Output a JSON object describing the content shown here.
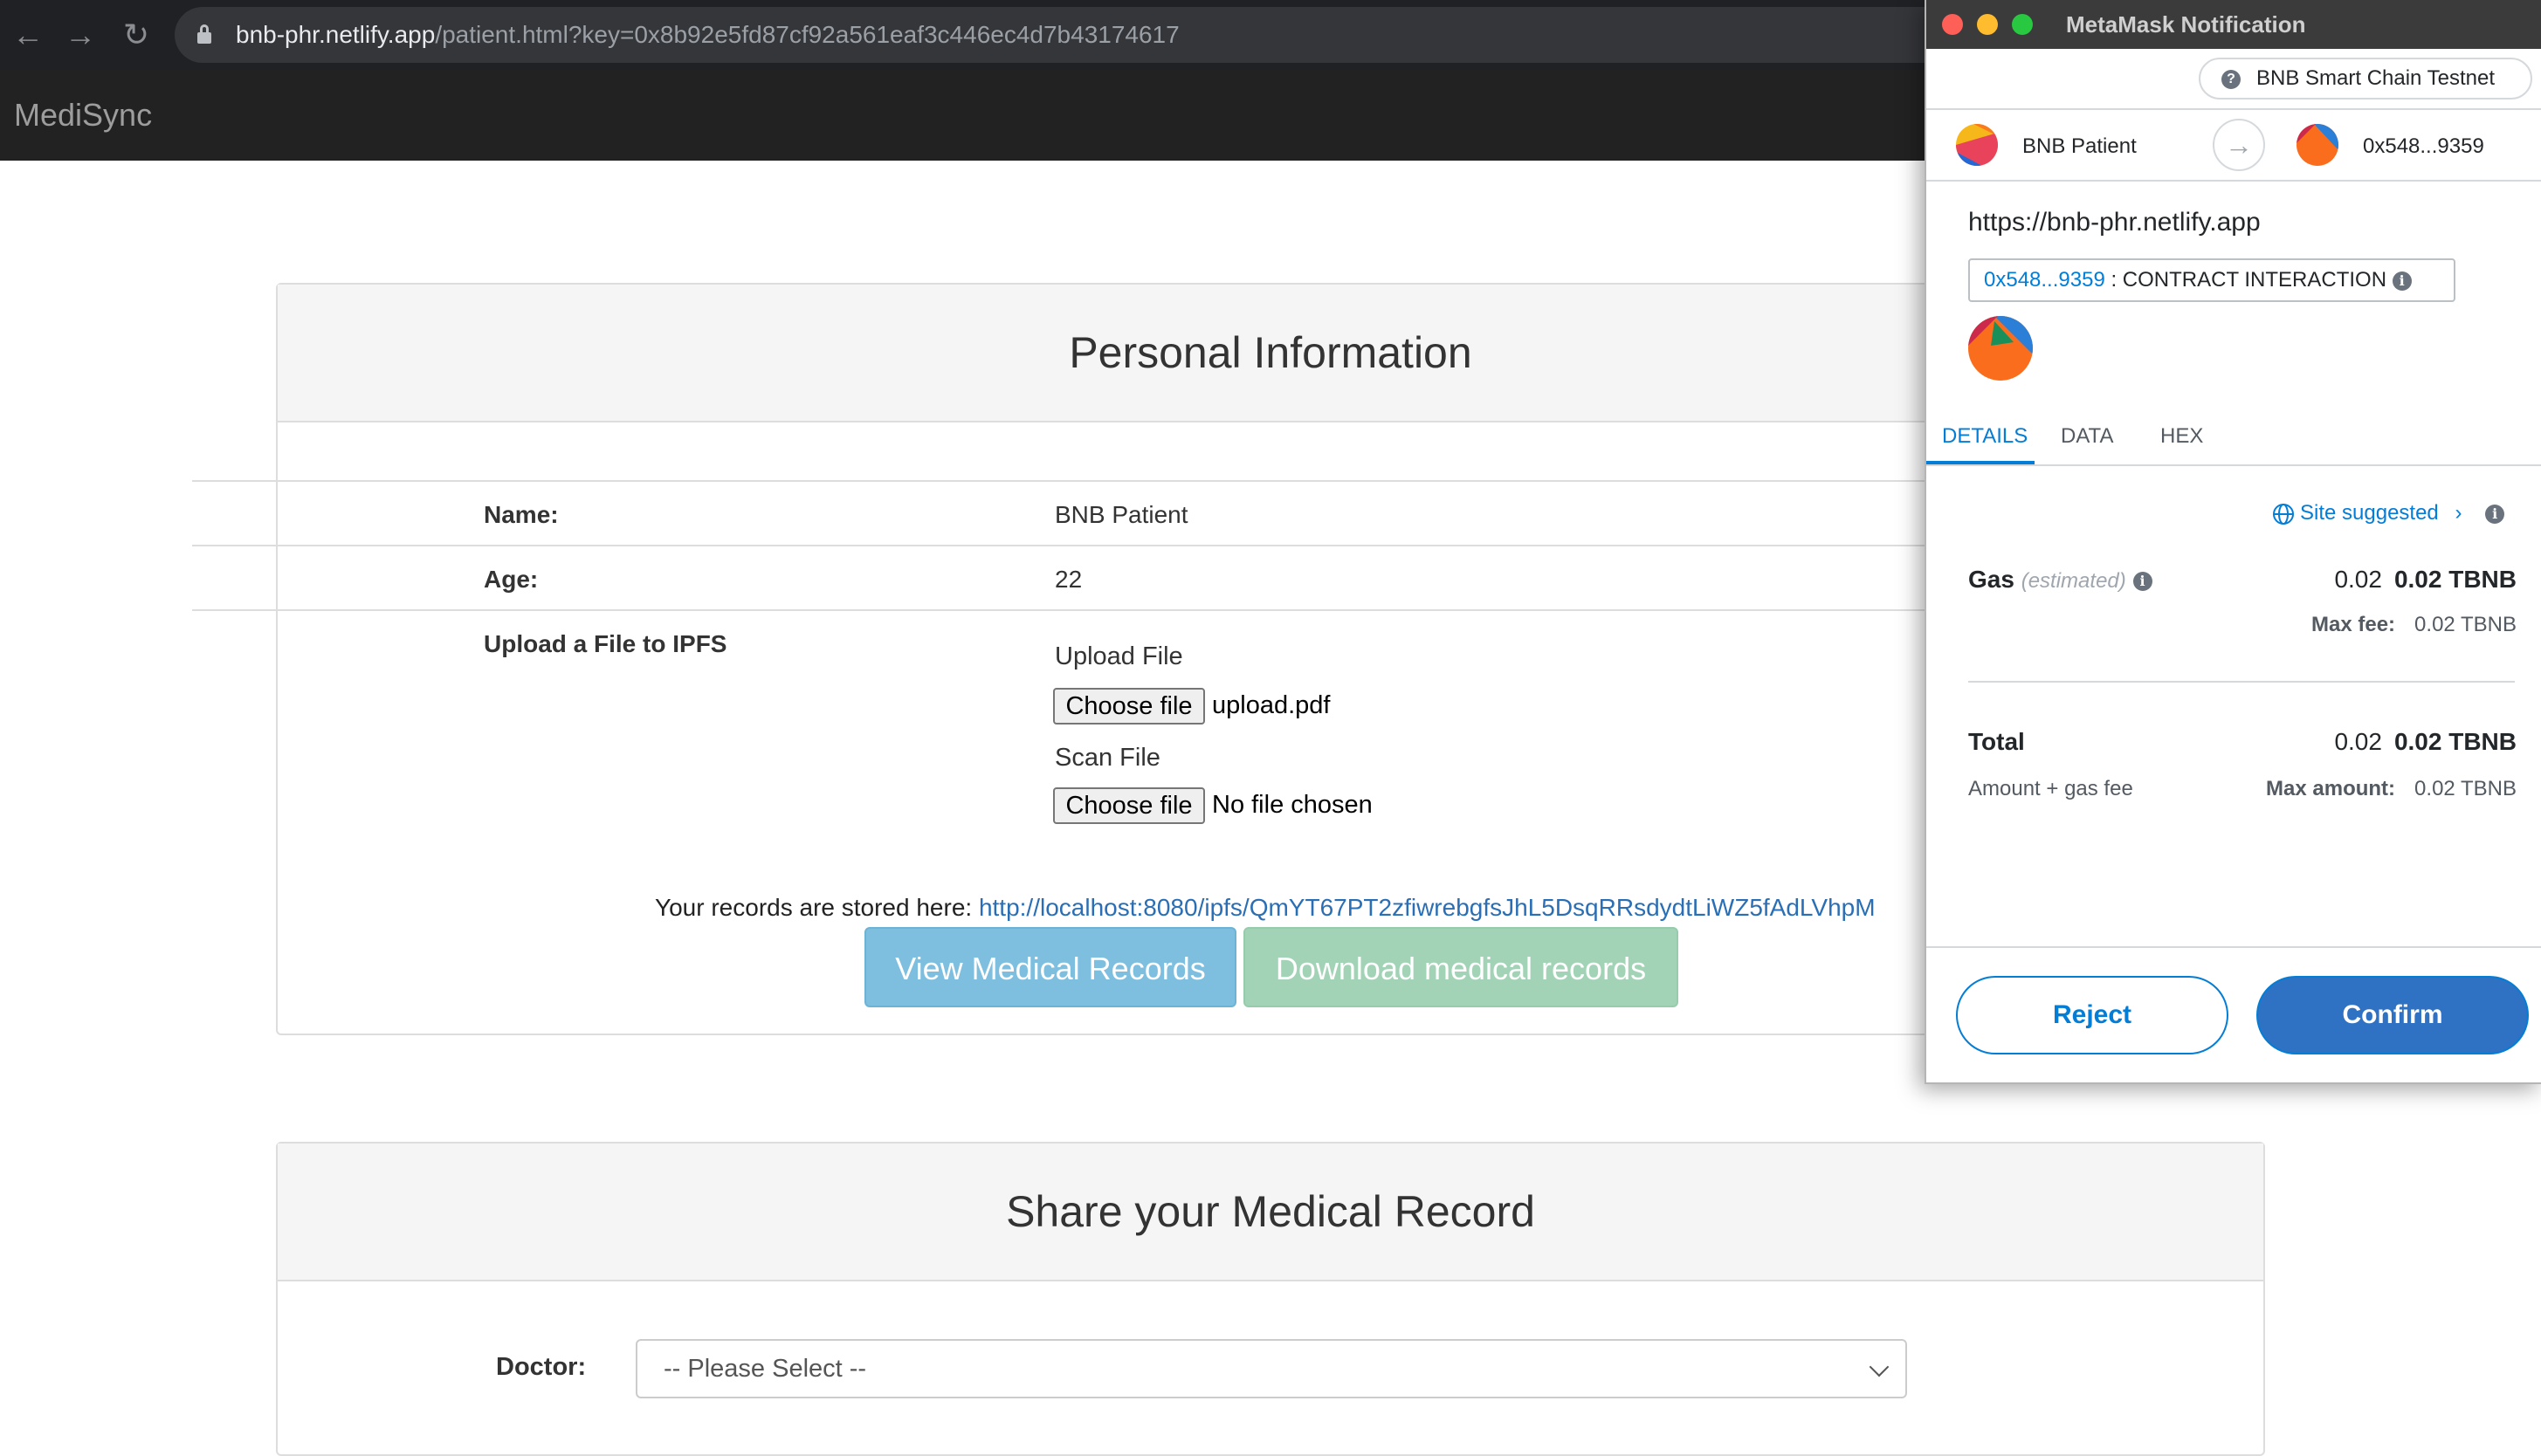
{
  "browser": {
    "url_host": "bnb-phr.netlify.app",
    "url_path": "/patient.html?key=0x8b92e5fd87cf92a561eaf3c446ec4d7b43174617"
  },
  "app": {
    "brand": "MediSync"
  },
  "personal": {
    "title": "Personal Information",
    "name_label": "Name:",
    "name_value": "BNB Patient",
    "age_label": "Age:",
    "age_value": "22",
    "upload_label": "Upload a File to IPFS",
    "upload_file_heading": "Upload File",
    "upload_button": "Choose file",
    "upload_file_name": "upload.pdf",
    "scan_file_heading": "Scan File",
    "scan_button": "Choose file",
    "scan_file_name": "No file chosen",
    "records_prefix": "Your records are stored here:",
    "records_link": "http://localhost:8080/ipfs/QmYT67PT2zfiwrebgfsJhL5DsqRRsdydtLiWZ5fAdLVhpM",
    "view_button": "View Medical Records",
    "download_button": "Download medical records"
  },
  "share": {
    "title": "Share your Medical Record",
    "doctor_label": "Doctor:",
    "doctor_selected": "-- Please Select --"
  },
  "metamask": {
    "window_title": "MetaMask Notification",
    "network": "BNB Smart Chain Testnet",
    "from_account": "BNB Patient",
    "to_account": "0x548...9359",
    "origin": "https://bnb-phr.netlify.app",
    "contract_address": "0x548...9359",
    "contract_label": ": CONTRACT INTERACTION",
    "tabs": [
      "DETAILS",
      "DATA",
      "HEX"
    ],
    "site_suggested": "Site suggested",
    "gas_label": "Gas",
    "gas_estimated": "(estimated)",
    "gas_plain": "0.02",
    "gas_bold": "0.02 TBNB",
    "max_fee_label": "Max fee:",
    "max_fee_value": "0.02 TBNB",
    "total_label": "Total",
    "total_plain": "0.02",
    "total_bold": "0.02 TBNB",
    "total_sub": "Amount + gas fee",
    "max_amount_label": "Max amount:",
    "max_amount_value": "0.02 TBNB",
    "reject": "Reject",
    "confirm": "Confirm",
    "accent": "#037dd6"
  }
}
